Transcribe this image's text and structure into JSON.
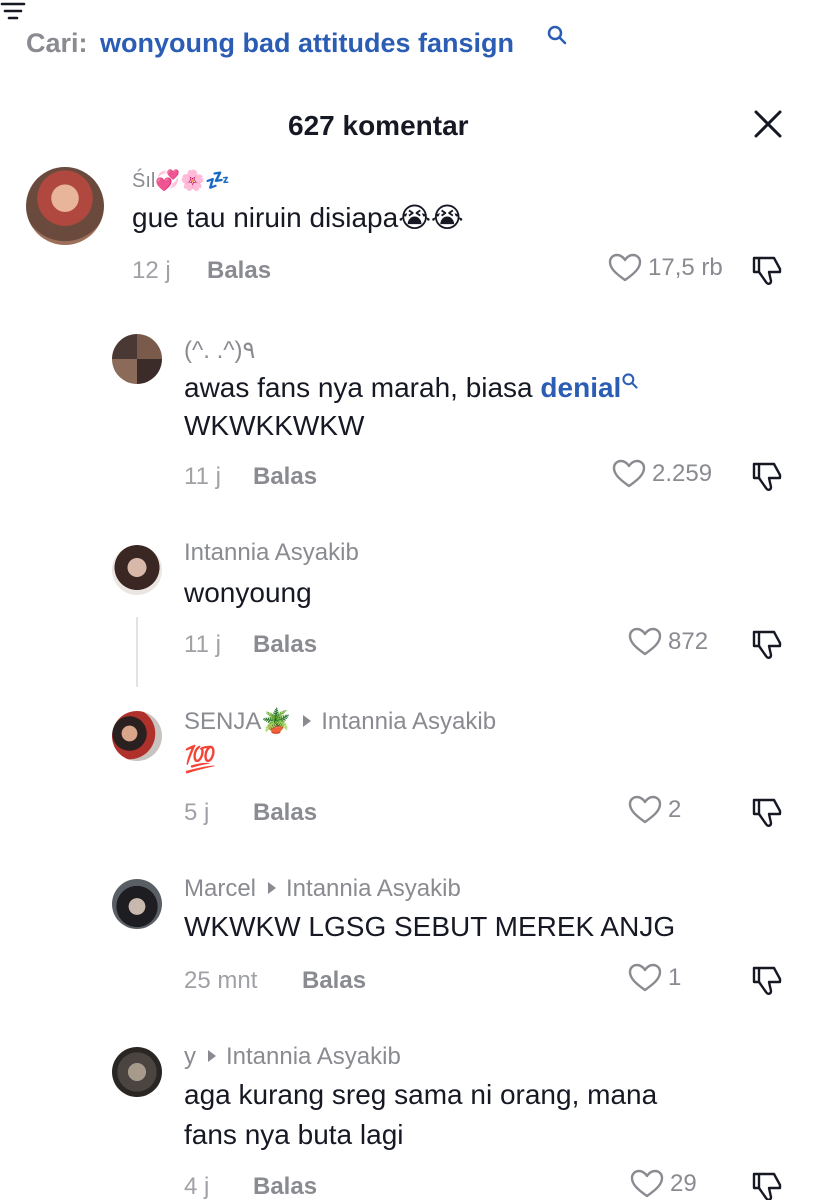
{
  "search": {
    "prefix": "Cari:",
    "query": "wonyoung bad attitudes fansign"
  },
  "header": {
    "count_title": "627 komentar"
  },
  "comments": [
    {
      "name": "Śıl💞🌸💤",
      "text": "gue tau niruin disiapa😭😭",
      "time": "12 j",
      "reply": "Balas",
      "likes": "17,5 rb"
    },
    {
      "name": "(^. .^)٩",
      "text_line1": "awas fans nya marah, biasa ",
      "link": "denial",
      "text_line2": "WKWKKWKW",
      "time": "11 j",
      "reply": "Balas",
      "likes": "2.259"
    },
    {
      "name": "Intannia Asyakib",
      "text": "wonyoung",
      "time": "11 j",
      "reply": "Balas",
      "likes": "872"
    },
    {
      "name": "SENJA🪴",
      "reply_to": "Intannia Asyakib",
      "text": "💯",
      "time": "5 j",
      "reply": "Balas",
      "likes": "2"
    },
    {
      "name": "Marcel",
      "reply_to": "Intannia Asyakib",
      "text": "WKWKW LGSG SEBUT MEREK ANJG",
      "time": "25 mnt",
      "reply": "Balas",
      "likes": "1"
    },
    {
      "name": "y",
      "reply_to": "Intannia Asyakib",
      "text_line1": "aga kurang sreg sama ni orang, mana",
      "text_line2": "fans nya buta lagi",
      "time": "4 j",
      "reply": "Balas",
      "likes": "29"
    }
  ]
}
